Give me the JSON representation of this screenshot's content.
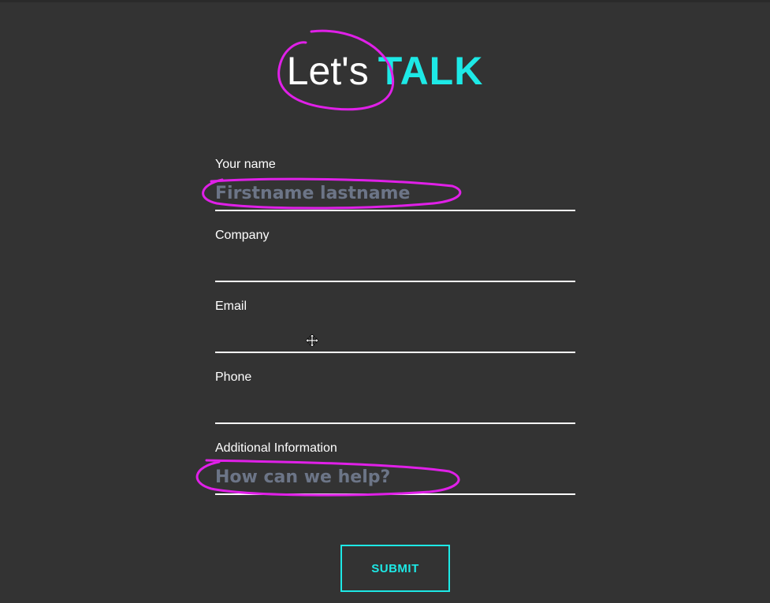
{
  "header": {
    "title_part1": "Let's",
    "title_part2": "TALK"
  },
  "form": {
    "fields": [
      {
        "label": "Your name",
        "placeholder": "Firstname lastname",
        "value": ""
      },
      {
        "label": "Company",
        "placeholder": "",
        "value": ""
      },
      {
        "label": "Email",
        "placeholder": "",
        "value": ""
      },
      {
        "label": "Phone",
        "placeholder": "",
        "value": ""
      },
      {
        "label": "Additional Information",
        "placeholder": "How can we help?",
        "value": ""
      }
    ],
    "submit_label": "SUBMIT"
  },
  "colors": {
    "background": "#333333",
    "accent": "#1de9e6",
    "placeholder": "#6c7587",
    "annotation": "#e020e8"
  },
  "icons": {
    "cursor": "move-cursor-icon"
  }
}
